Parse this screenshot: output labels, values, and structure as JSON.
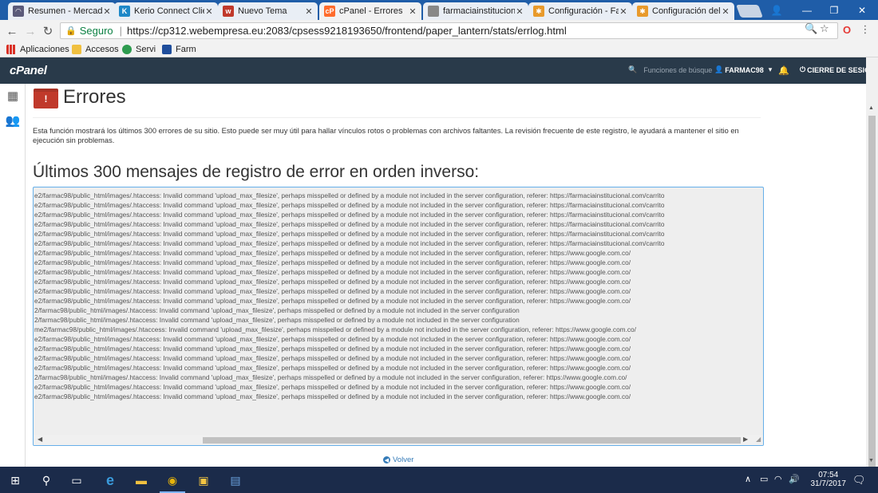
{
  "browser": {
    "tabs": [
      {
        "label": "Resumen - Mercad",
        "active": false,
        "favicon_color": "#5a5a7a"
      },
      {
        "label": "Kerio Connect Clie",
        "active": false,
        "favicon_color": "#1e88c8"
      },
      {
        "label": "Nuevo Tema",
        "active": false,
        "favicon_color": "#c0392b"
      },
      {
        "label": "cPanel - Errores",
        "active": true,
        "favicon_color": "#ff6c2c"
      },
      {
        "label": "farmaciainstitucion",
        "active": false,
        "favicon_color": "#888888"
      },
      {
        "label": "Configuración - Fa",
        "active": false,
        "favicon_color": "#e89a2c"
      },
      {
        "label": "Configuración del",
        "active": false,
        "favicon_color": "#e89a2c"
      }
    ],
    "address": {
      "secure_label": "Seguro",
      "url": "https://cp312.webempresa.eu:2083/cpsess9218193650/frontend/paper_lantern/stats/errlog.html"
    },
    "bookmarks": [
      {
        "label": "Aplicaciones",
        "icon": "apps-grid-icon"
      },
      {
        "label": "Accesos",
        "icon": "folder-icon"
      },
      {
        "label": "Servi",
        "icon": "servi-icon"
      },
      {
        "label": "Farm",
        "icon": "farm-icon"
      }
    ]
  },
  "cpanel": {
    "logo": "cPanel",
    "search_placeholder": "Funciones de búsque",
    "user": "FARMAC98",
    "logout": "CIERRE DE SESIÓN"
  },
  "page": {
    "title": "Errores",
    "description": "Esta función mostrará los últimos 300 errores de su sitio. Esto puede ser muy útil para hallar vínculos rotos o problemas con archivos faltantes. La revisión frecuente de este registro, le ayudará a mantener el sitio en ejecución sin problemas.",
    "subtitle": "Últimos 300 mensajes de registro de error en orden inverso:",
    "log_lines": [
      "e2/farmac98/public_html/images/.htaccess: Invalid command 'upload_max_filesize', perhaps misspelled or defined by a module not included in the server configuration, referer: https://farmaciainstitucional.com/carrito",
      "e2/farmac98/public_html/images/.htaccess: Invalid command 'upload_max_filesize', perhaps misspelled or defined by a module not included in the server configuration, referer: https://farmaciainstitucional.com/carrito",
      "e2/farmac98/public_html/images/.htaccess: Invalid command 'upload_max_filesize', perhaps misspelled or defined by a module not included in the server configuration, referer: https://farmaciainstitucional.com/carrito",
      "e2/farmac98/public_html/images/.htaccess: Invalid command 'upload_max_filesize', perhaps misspelled or defined by a module not included in the server configuration, referer: https://farmaciainstitucional.com/carrito",
      "e2/farmac98/public_html/images/.htaccess: Invalid command 'upload_max_filesize', perhaps misspelled or defined by a module not included in the server configuration, referer: https://farmaciainstitucional.com/carrito",
      "e2/farmac98/public_html/images/.htaccess: Invalid command 'upload_max_filesize', perhaps misspelled or defined by a module not included in the server configuration, referer: https://farmaciainstitucional.com/carrito",
      "e2/farmac98/public_html/images/.htaccess: Invalid command 'upload_max_filesize', perhaps misspelled or defined by a module not included in the server configuration, referer: https://www.google.com.co/",
      "e2/farmac98/public_html/images/.htaccess: Invalid command 'upload_max_filesize', perhaps misspelled or defined by a module not included in the server configuration, referer: https://www.google.com.co/",
      "e2/farmac98/public_html/images/.htaccess: Invalid command 'upload_max_filesize', perhaps misspelled or defined by a module not included in the server configuration, referer: https://www.google.com.co/",
      "e2/farmac98/public_html/images/.htaccess: Invalid command 'upload_max_filesize', perhaps misspelled or defined by a module not included in the server configuration, referer: https://www.google.com.co/",
      "e2/farmac98/public_html/images/.htaccess: Invalid command 'upload_max_filesize', perhaps misspelled or defined by a module not included in the server configuration, referer: https://www.google.com.co/",
      "e2/farmac98/public_html/images/.htaccess: Invalid command 'upload_max_filesize', perhaps misspelled or defined by a module not included in the server configuration, referer: https://www.google.com.co/",
      "2/farmac98/public_html/images/.htaccess: Invalid command 'upload_max_filesize', perhaps misspelled or defined by a module not included in the server configuration",
      "2/farmac98/public_html/images/.htaccess: Invalid command 'upload_max_filesize', perhaps misspelled or defined by a module not included in the server configuration",
      "me2/farmac98/public_html/images/.htaccess: Invalid command 'upload_max_filesize', perhaps misspelled or defined by a module not included in the server configuration, referer: https://www.google.com.co/",
      "e2/farmac98/public_html/images/.htaccess: Invalid command 'upload_max_filesize', perhaps misspelled or defined by a module not included in the server configuration, referer: https://www.google.com.co/",
      "e2/farmac98/public_html/images/.htaccess: Invalid command 'upload_max_filesize', perhaps misspelled or defined by a module not included in the server configuration, referer: https://www.google.com.co/",
      "e2/farmac98/public_html/images/.htaccess: Invalid command 'upload_max_filesize', perhaps misspelled or defined by a module not included in the server configuration, referer: https://www.google.com.co/",
      "e2/farmac98/public_html/images/.htaccess: Invalid command 'upload_max_filesize', perhaps misspelled or defined by a module not included in the server configuration, referer: https://www.google.com.co/",
      "2/farmac98/public_html/images/.htaccess: Invalid command 'upload_max_filesize', perhaps misspelled or defined by a module not included in the server configuration, referer: https://www.google.com.co/",
      "e2/farmac98/public_html/images/.htaccess: Invalid command 'upload_max_filesize', perhaps misspelled or defined by a module not included in the server configuration, referer: https://www.google.com.co/",
      "e2/farmac98/public_html/images/.htaccess: Invalid command 'upload_max_filesize', perhaps misspelled or defined by a module not included in the server configuration, referer: https://www.google.com.co/"
    ],
    "back_label": "Volver"
  },
  "taskbar": {
    "time": "07:54",
    "date": "31/7/2017"
  },
  "colors": {
    "tabstrip": "#1f5da8",
    "cpanel_header": "#293a4a",
    "taskbar": "#1b2b4a",
    "error_icon": "#c0392b",
    "link": "#337ab7"
  }
}
